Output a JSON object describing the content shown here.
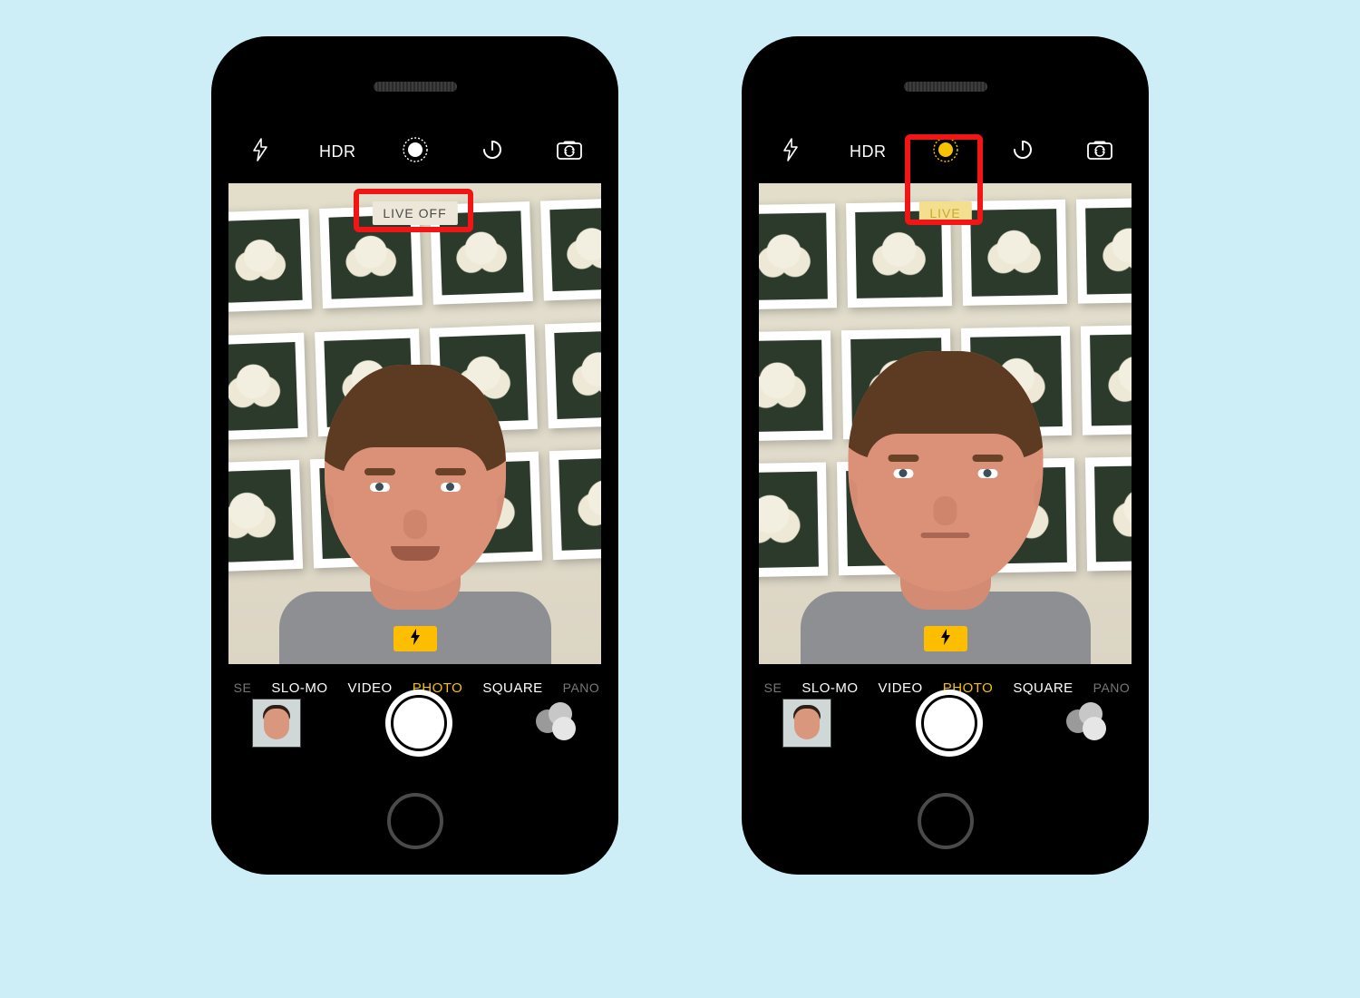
{
  "page_background": "#cdeef6",
  "phones": {
    "left": {
      "live_photo_state": "off",
      "live_badge_text": "LIVE OFF",
      "highlight_target": "live-badge"
    },
    "right": {
      "live_photo_state": "on",
      "live_badge_text": "LIVE",
      "highlight_target": "live-photo-button"
    }
  },
  "topbar": {
    "hdr_label": "HDR",
    "icons": {
      "flash": "flash-icon",
      "hdr": "hdr-icon",
      "live": "live-photo-icon",
      "timer": "timer-icon",
      "switch": "camera-switch-icon"
    }
  },
  "modes": {
    "items": [
      "SE",
      "SLO-MO",
      "VIDEO",
      "PHOTO",
      "SQUARE",
      "PANO"
    ],
    "active": "PHOTO",
    "edge_left_partial": "SE",
    "edge_right_partial": "PANO"
  },
  "controls": {
    "shutter": "shutter-button",
    "thumbnail": "last-photo-thumbnail",
    "filters": "filters-button"
  },
  "viewfinder": {
    "flash_indicator": "auto",
    "scene_description": "selfie-portrait-indoors-framed-art-wall"
  },
  "colors": {
    "accent_yellow": "#f6c200",
    "highlight_red": "#f11515",
    "flash_badge": "#fdbe00"
  }
}
